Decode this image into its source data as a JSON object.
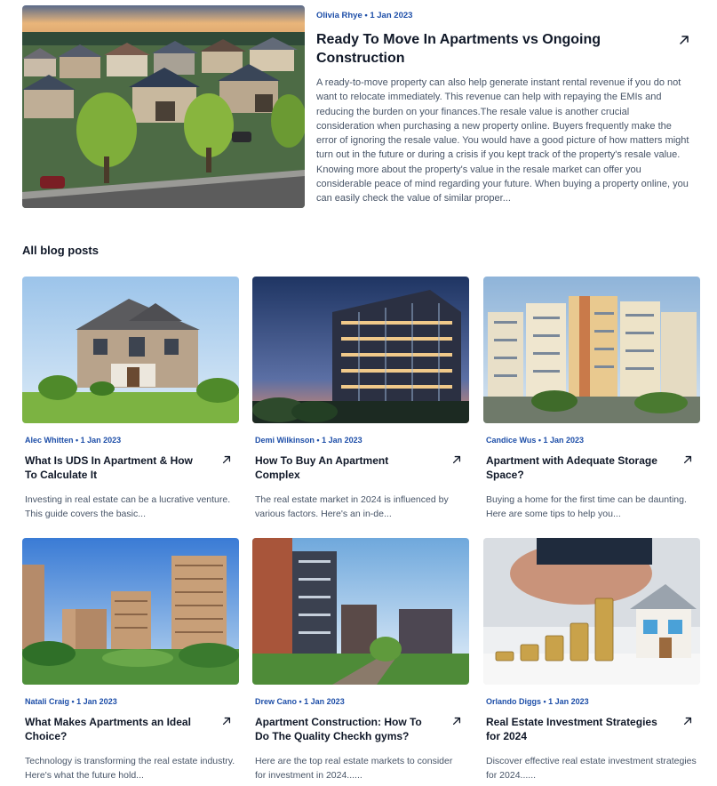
{
  "featured": {
    "meta": "Olivia Rhye • 1 Jan 2023",
    "title": "Ready To Move In Apartments vs Ongoing Construction",
    "excerpt": "A ready-to-move property can also help generate instant rental revenue if you do not want to relocate immediately. This revenue can help with repaying the EMIs and reducing the burden on your finances.The resale value is another crucial consideration when purchasing a new property online. Buyers frequently make the error of ignoring the resale value. You would have a good picture of how matters might turn out in the future or during a crisis if you kept track of the property's resale value. Knowing more about the property's value in the resale market can offer you considerable peace of mind regarding your future. When buying a property online, you can easily check the value of similar proper...",
    "image_icon": "suburban-houses-aerial-image"
  },
  "section": {
    "title": "All blog posts"
  },
  "posts": [
    {
      "meta": "Alec Whitten • 1 Jan 2023",
      "title": "What Is UDS In Apartment & How To Calculate It",
      "excerpt": "Investing in real estate can be a lucrative venture. This guide covers the basic...",
      "image_icon": "suburban-house-image"
    },
    {
      "meta": "Demi Wilkinson • 1 Jan 2023",
      "title": "How To Buy An Apartment Complex",
      "excerpt": "The real estate market in 2024 is influenced by various factors. Here's an in-de...",
      "image_icon": "modern-building-dusk-image"
    },
    {
      "meta": "Candice Wus • 1 Jan 2023",
      "title": "Apartment with Adequate Storage Space?",
      "excerpt": "Buying a home for the first time can be daunting. Here are some tips to help you...",
      "image_icon": "apartment-blocks-image"
    },
    {
      "meta": "Natali Craig • 1 Jan 2023",
      "title": "What Makes Apartments an Ideal Choice?",
      "excerpt": "Technology is transforming the real estate industry. Here's what the future hold...",
      "image_icon": "high-rise-towers-image"
    },
    {
      "meta": "Drew Cano • 1 Jan 2023",
      "title": "Apartment Construction: How To Do The Quality Checkh gyms?",
      "excerpt": "Here are the top real estate markets to consider for investment in 2024......",
      "image_icon": "apartment-walkway-image"
    },
    {
      "meta": "Orlando Diggs • 1 Jan 2023",
      "title": "Real Estate Investment Strategies for 2024",
      "excerpt": "Discover effective real estate investment strategies for 2024......",
      "image_icon": "coins-house-image"
    }
  ]
}
